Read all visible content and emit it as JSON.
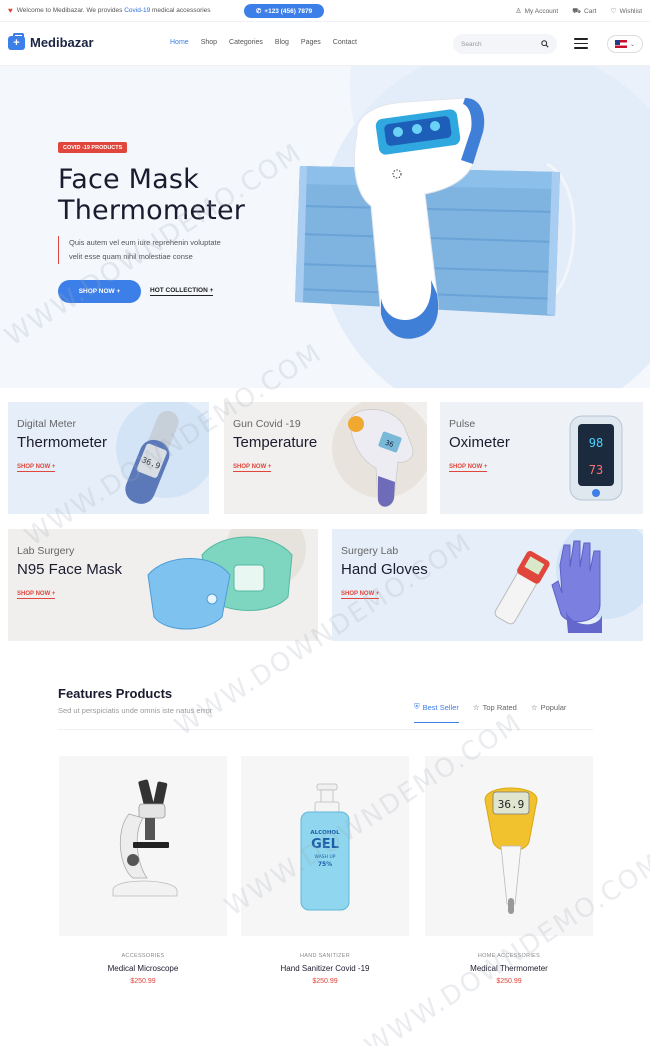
{
  "topbar": {
    "welcome_prefix": "Welcome to Medibazar. We provides",
    "welcome_highlight": "Covid-19",
    "welcome_suffix": "medical accessories",
    "phone": "+123 (456) 7879",
    "links": {
      "account": "My Account",
      "cart": "Cart",
      "wishlist": "Wishlist"
    }
  },
  "header": {
    "logo": "Medibazar",
    "nav": [
      "Home",
      "Shop",
      "Categories",
      "Blog",
      "Pages",
      "Contact"
    ],
    "active_nav": "Home",
    "search_placeholder": "Search"
  },
  "hero": {
    "tag": "COVID -19 PRODUCTS",
    "title_line1": "Face Mask",
    "title_line2": "Thermometer",
    "desc_line1": "Quis autem vel eum iure reprehenin voluptate",
    "desc_line2": "velit esse quam nihil molestiae conse",
    "btn_shop": "SHOP NOW +",
    "btn_hot": "HOT COLLECTION +"
  },
  "categories": [
    {
      "sub": "Digital Meter",
      "name": "Thermometer",
      "link": "SHOP NOW +"
    },
    {
      "sub": "Gun Covid -19",
      "name": "Temperature",
      "link": "SHOP NOW +"
    },
    {
      "sub": "Pulse",
      "name": "Oximeter",
      "link": "SHOP NOW +"
    },
    {
      "sub": "Lab Surgery",
      "name": "N95 Face Mask",
      "link": "SHOP NOW +"
    },
    {
      "sub": "Surgery Lab",
      "name": "Hand Gloves",
      "link": "SHOP NOW +"
    }
  ],
  "features": {
    "title": "Features Products",
    "subtitle": "Sed ut perspiciatis unde omnis iste natus error",
    "tabs": [
      "Best Seller",
      "Top Rated",
      "Popular"
    ],
    "products": [
      {
        "category": "ACCESSORIES",
        "name": "Medical Microscope",
        "price": "$250.99"
      },
      {
        "category": "HAND SANITIZER",
        "name": "Hand Sanitizer Covid -19",
        "price": "$250.99"
      },
      {
        "category": "HOME ACCESSORIES",
        "name": "Medical Thermometer",
        "price": "$250.99"
      }
    ]
  },
  "device_readings": {
    "oximeter_top": "98",
    "oximeter_bottom": "73",
    "gun": "36",
    "digital": "36.9"
  },
  "sanitizer_label": [
    "ALCOHOL",
    "GEL",
    "WASH UP",
    "75%"
  ],
  "watermark": "WWW.DOWNDEMO.COM",
  "colors": {
    "accent": "#3d7fe8",
    "red": "#e0463b"
  }
}
